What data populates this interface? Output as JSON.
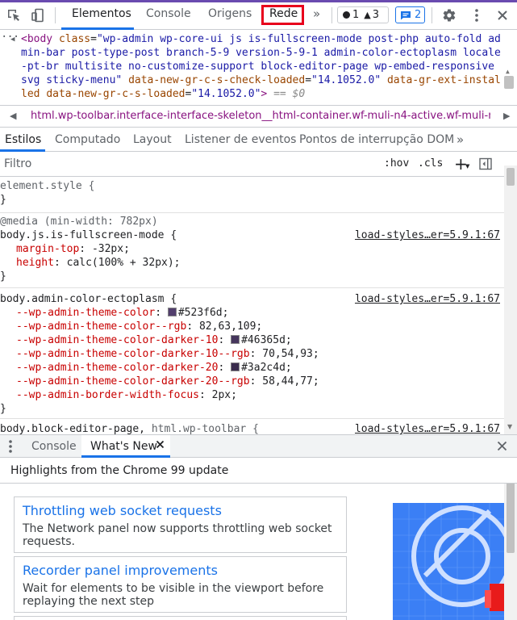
{
  "toolbar": {
    "tabs": [
      "Elementos",
      "Console",
      "Origens",
      "Rede"
    ],
    "more": "»",
    "errors": "1",
    "warnings": "3",
    "messages": "2",
    "accent": "#1a73e8",
    "highlight_color": "#e8001c"
  },
  "dom": {
    "line1_pre": "<body ",
    "class_attr": "class",
    "class_value": "\"wp-admin wp-core-ui js is-fullscreen-mode post-php auto-fold admin-bar post-type-post branch-5-9 version-5-9-1 admin-color-ectoplasm locale-pt-br multisite no-customize-support block-editor-page wp-embed-responsive svg sticky-menu\"",
    "attr2_name": "data-new-gr-c-s-check-loaded",
    "attr2_val": "\"14.1052.0\"",
    "attr3_name": "data-gr-ext-installed",
    "attr4_name": "data-new-gr-c-s-loaded",
    "attr4_val": "\"14.1052.0\"",
    "close": ">",
    "eq0": " == $0"
  },
  "breadcrumb": "html.wp-toolbar.interface-interface-skeleton__html-container.wf-muli-n4-active.wf-muli-n6-a",
  "styles_tabs": [
    "Estilos",
    "Computado",
    "Layout",
    "Listener de eventos",
    "Pontos de interrupção DOM"
  ],
  "filter": {
    "placeholder": "Filtro",
    "hov": ":hov",
    "cls": ".cls",
    "plus": "+"
  },
  "rules": [
    {
      "selector": "element.style {",
      "close": "}"
    },
    {
      "media": "@media (min-width: 782px)",
      "selector": "body.js.is-fullscreen-mode {",
      "link": "load-styles…er=5.9.1:67",
      "props": [
        {
          "name": "margin-top",
          "value": "-32px;"
        },
        {
          "name": "height",
          "value": "calc(100% + 32px);"
        }
      ],
      "close": "}"
    },
    {
      "selector": "body.admin-color-ectoplasm {",
      "link": "load-styles…er=5.9.1:67",
      "props": [
        {
          "name": "--wp-admin-theme-color",
          "value": "#523f6d;",
          "swatch": "#523f6d"
        },
        {
          "name": "--wp-admin-theme-color--rgb",
          "value": "82,63,109;"
        },
        {
          "name": "--wp-admin-theme-color-darker-10",
          "value": "#46365d;",
          "swatch": "#46365d"
        },
        {
          "name": "--wp-admin-theme-color-darker-10--rgb",
          "value": "70,54,93;"
        },
        {
          "name": "--wp-admin-theme-color-darker-20",
          "value": "#3a2c4d;",
          "swatch": "#3a2c4d"
        },
        {
          "name": "--wp-admin-theme-color-darker-20--rgb",
          "value": "58,44,77;"
        },
        {
          "name": "--wp-admin-border-width-focus",
          "value": "2px;"
        }
      ],
      "close": "}"
    },
    {
      "selector": "body.block-editor-page,",
      "selector_extra": "html.wp-toolbar {",
      "link": "load-styles…er=5.9.1:67"
    }
  ],
  "drawer": {
    "tabs": [
      "Console",
      "What's New"
    ],
    "highlights": "Highlights from the Chrome 99 update",
    "cards": [
      {
        "title": "Throttling web socket requests",
        "desc": "The Network panel now supports throttling web socket requests."
      },
      {
        "title": "Recorder panel improvements",
        "desc": "Wait for elements to be visible in the viewport before replaying the next step"
      }
    ]
  }
}
